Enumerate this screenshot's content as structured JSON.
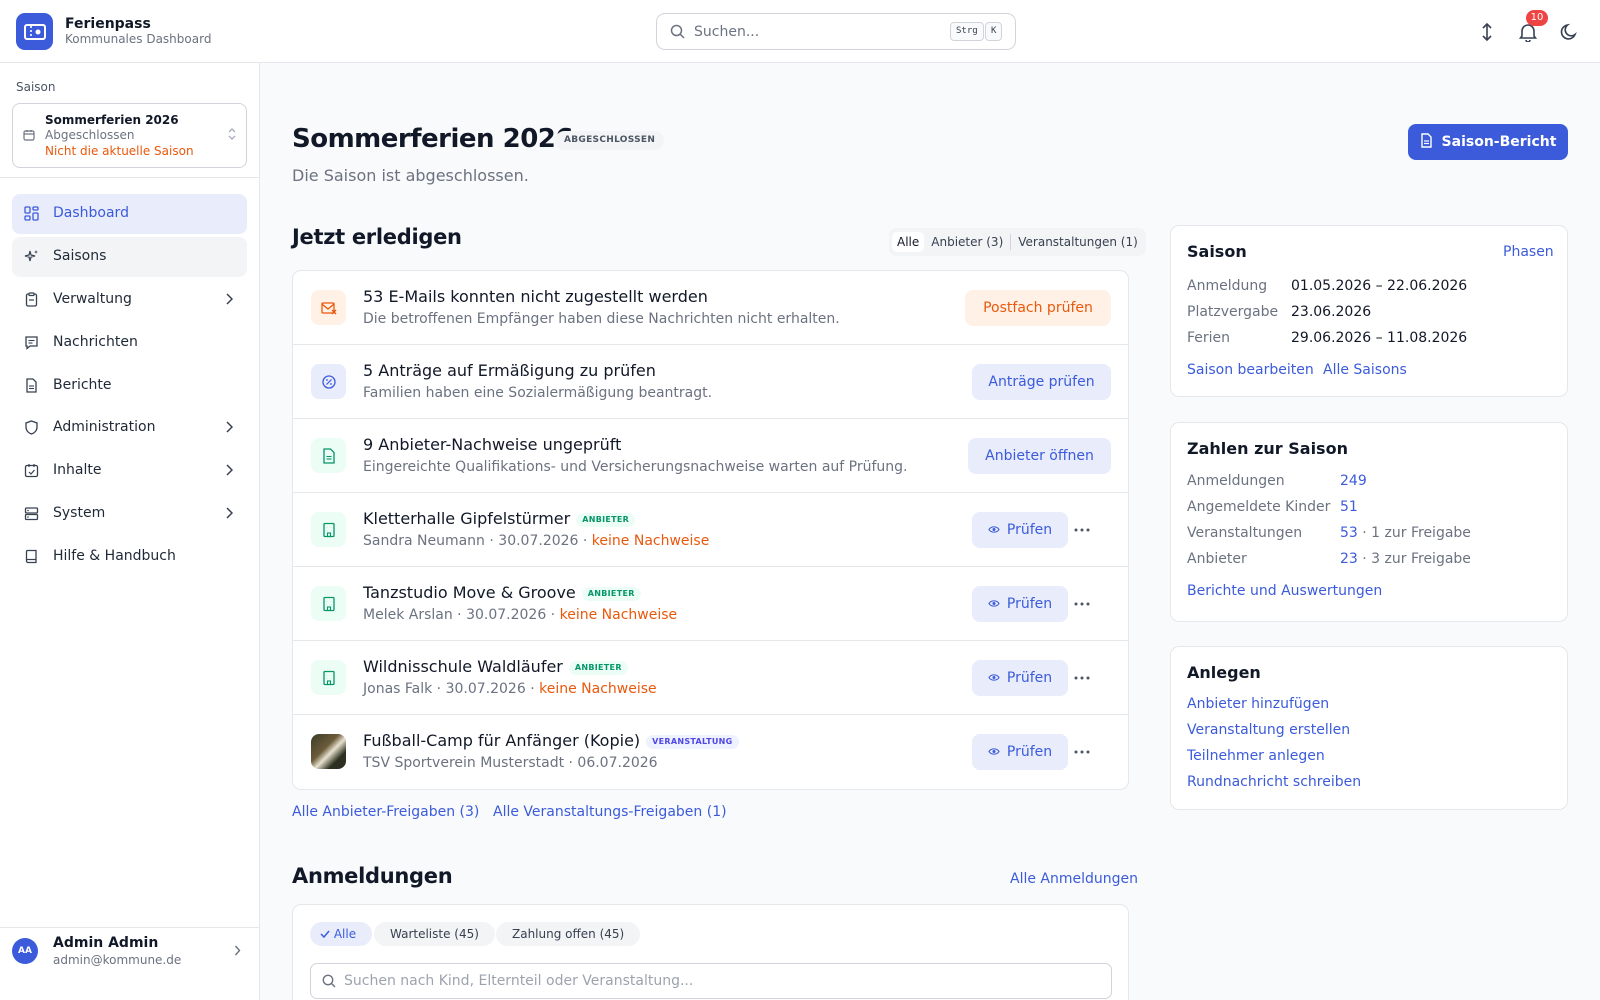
{
  "app": {
    "title": "Ferienpass",
    "subtitle": "Kommunales Dashboard"
  },
  "search": {
    "placeholder": "Suchen...",
    "shortcut_1": "Strg",
    "shortcut_2": "K"
  },
  "topbar": {
    "notification_count": "10",
    "icons": [
      "sort-icon",
      "bell-icon",
      "moon-icon"
    ]
  },
  "sidebar": {
    "saison_label": "Saison",
    "saison_select": {
      "name": "Sommerferien 2026",
      "state": "Abgeschlossen",
      "warning": "Nicht die aktuelle Saison"
    },
    "items": [
      {
        "label": "Dashboard",
        "icon": "dashboard-icon",
        "active": true
      },
      {
        "label": "Saisons",
        "icon": "sparkles-icon"
      },
      {
        "label": "Verwaltung",
        "icon": "clipboard-icon",
        "expandable": true
      },
      {
        "label": "Nachrichten",
        "icon": "message-icon"
      },
      {
        "label": "Berichte",
        "icon": "document-icon"
      },
      {
        "label": "Administration",
        "icon": "shield-icon",
        "expandable": true
      },
      {
        "label": "Inhalte",
        "icon": "calendar-check-icon",
        "expandable": true
      },
      {
        "label": "System",
        "icon": "server-icon",
        "expandable": true
      },
      {
        "label": "Hilfe & Handbuch",
        "icon": "book-icon"
      }
    ],
    "user": {
      "initials": "AA",
      "name": "Admin Admin",
      "email": "admin@kommune.de"
    }
  },
  "header": {
    "title": "Sommerferien 2026",
    "badge": "ABGESCHLOSSEN",
    "subtitle": "Die Saison ist abgeschlossen.",
    "report_button": "Saison-Bericht"
  },
  "tasks": {
    "title": "Jetzt erledigen",
    "filters": [
      "Alle",
      "Anbieter (3)",
      "Veranstaltungen (1)"
    ],
    "items": [
      {
        "title": "53 E-Mails konnten nicht zugestellt werden",
        "desc": "Die betroffenen Empfänger haben diese Nachrichten nicht erhalten.",
        "button": "Postfach prüfen",
        "icon": "mail-error-icon"
      },
      {
        "title": "5 Anträge auf Ermäßigung zu prüfen",
        "desc": "Familien haben eine Sozialermäßigung beantragt.",
        "button": "Anträge prüfen",
        "icon": "discount-icon"
      },
      {
        "title": "9 Anbieter-Nachweise ungeprüft",
        "desc": "Eingereichte Qualifikations- und Versicherungsnachweise warten auf Prüfung.",
        "button": "Anbieter öffnen",
        "icon": "file-check-icon"
      },
      {
        "title": "Kletterhalle Gipfelstürmer",
        "badge": "ANBIETER",
        "meta": "Sandra Neumann · 30.07.2026 · ",
        "warning": "keine Nachweise",
        "button": "Prüfen",
        "icon": "building-icon"
      },
      {
        "title": "Tanzstudio Move & Groove",
        "badge": "ANBIETER",
        "meta": "Melek Arslan · 30.07.2026 · ",
        "warning": "keine Nachweise",
        "button": "Prüfen",
        "icon": "building-icon"
      },
      {
        "title": "Wildnisschule Waldläufer",
        "badge": "ANBIETER",
        "meta": "Jonas Falk · 30.07.2026 · ",
        "warning": "keine Nachweise",
        "button": "Prüfen",
        "icon": "building-icon"
      },
      {
        "title": "Fußball-Camp für Anfänger (Kopie)",
        "badge": "VERANSTALTUNG",
        "meta": "TSV Sportverein Musterstadt · 06.07.2026",
        "button": "Prüfen",
        "icon": "event-thumbnail"
      }
    ],
    "links": [
      "Alle Anbieter-Freigaben (3)",
      "Alle Veranstaltungs-Freigaben (1)"
    ]
  },
  "registrations": {
    "title": "Anmeldungen",
    "all_link": "Alle Anmeldungen",
    "chips": [
      "Alle",
      "Warteliste (45)",
      "Zahlung offen (45)"
    ],
    "search_placeholder": "Suchen nach Kind, Elternteil oder Veranstaltung..."
  },
  "saison_card": {
    "title": "Saison",
    "phases_link": "Phasen",
    "rows": [
      {
        "label": "Anmeldung",
        "value": "01.05.2026 – 22.06.2026"
      },
      {
        "label": "Platzvergabe",
        "value": "23.06.2026"
      },
      {
        "label": "Ferien",
        "value": "29.06.2026 – 11.08.2026"
      }
    ],
    "links": [
      "Saison bearbeiten",
      "Alle Saisons"
    ]
  },
  "stats_card": {
    "title": "Zahlen zur Saison",
    "rows": [
      {
        "label": "Anmeldungen",
        "value": "249",
        "extra": ""
      },
      {
        "label": "Angemeldete Kinder",
        "value": "51",
        "extra": ""
      },
      {
        "label": "Veranstaltungen",
        "value": "53",
        "extra": " · 1 zur Freigabe"
      },
      {
        "label": "Anbieter",
        "value": "23",
        "extra": " · 3 zur Freigabe"
      }
    ],
    "link": "Berichte und Auswertungen"
  },
  "create_card": {
    "title": "Anlegen",
    "links": [
      "Anbieter hinzufügen",
      "Veranstaltung erstellen",
      "Teilnehmer anlegen",
      "Rundnachricht schreiben"
    ]
  },
  "colors": {
    "primary": "#3b5bdb",
    "warning": "#ea580c",
    "success": "#059669",
    "danger": "#ef4444"
  }
}
